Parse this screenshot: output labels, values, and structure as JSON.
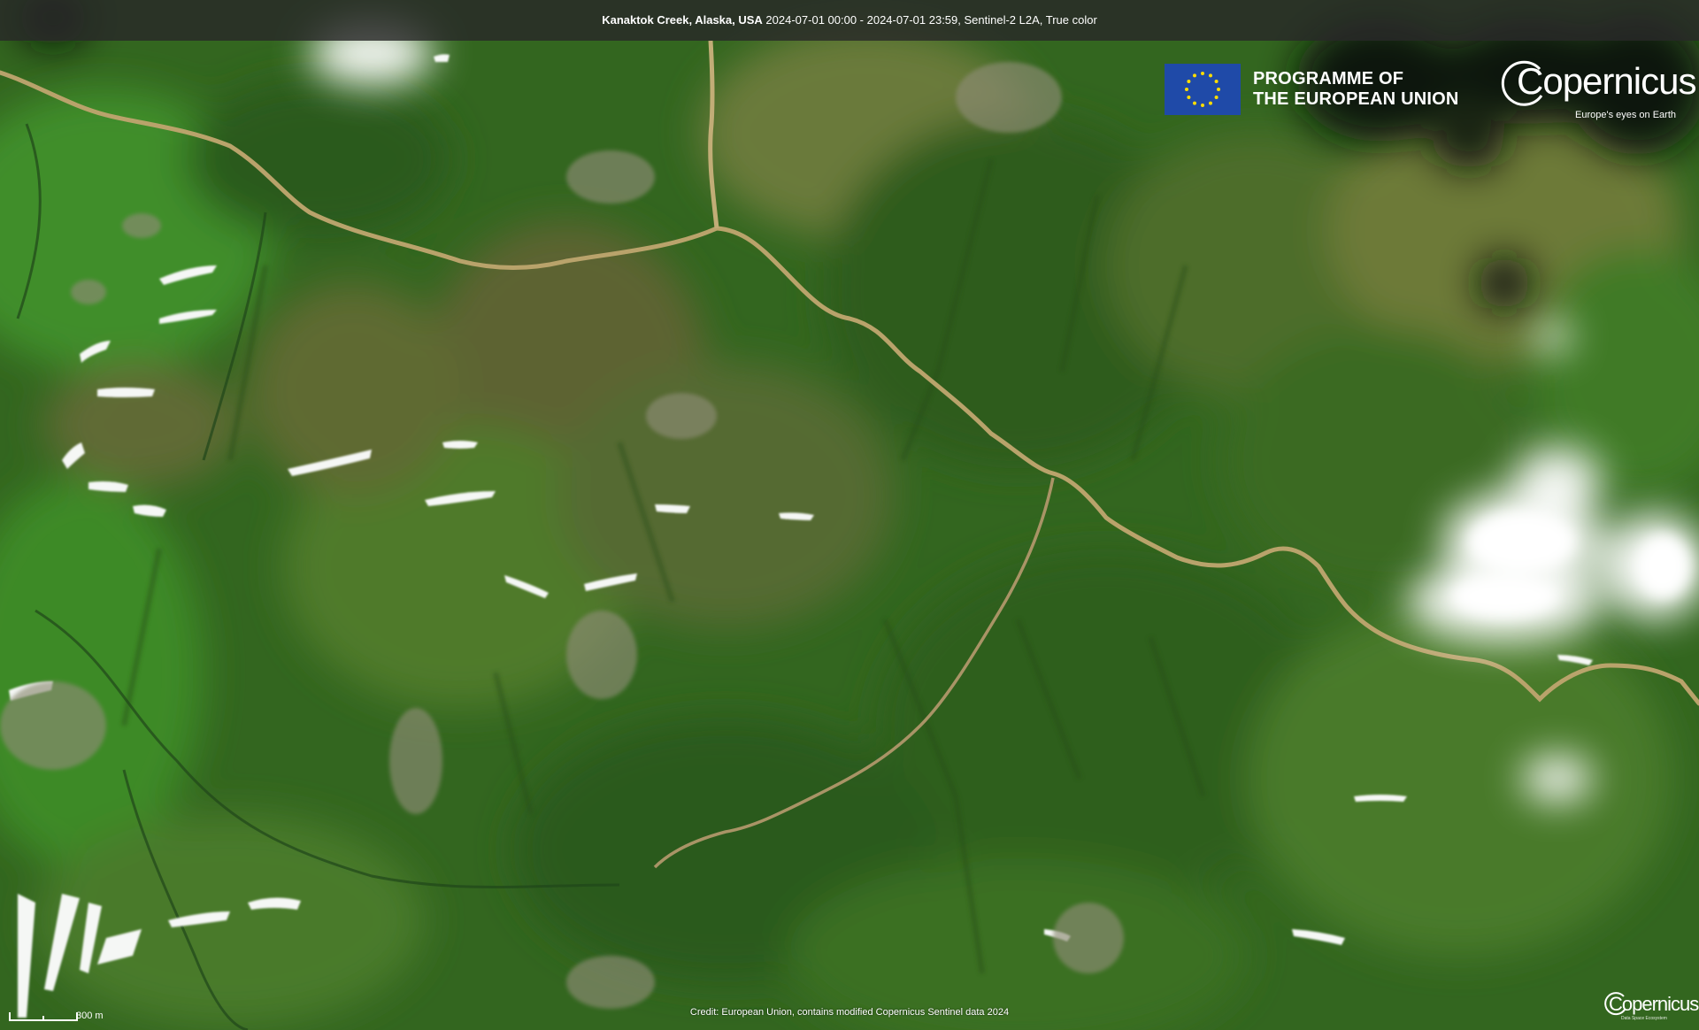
{
  "title_bar": {
    "location": "Kanaktok Creek, Alaska, USA",
    "details": " 2024-07-01 00:00 - 2024-07-01 23:59, Sentinel-2 L2A, True color"
  },
  "eu_logo": {
    "line1": "PROGRAMME OF",
    "line2": "THE EUROPEAN UNION",
    "flag_color": "#1f4aa8",
    "star_color": "#ffdd00"
  },
  "copernicus_logo": {
    "wordmark": "Copernicus",
    "tagline": "Europe's eyes on Earth"
  },
  "credit": "Credit: European Union, contains modified Copernicus Sentinel data 2024",
  "scale_bar": {
    "label": "300 m"
  },
  "mini_logo": {
    "wordmark": "Copernicus",
    "tagline": "Data Space Ecosystem"
  },
  "colors": {
    "vegetation_dark": "#2e5f1d",
    "vegetation_light": "#3f8a28",
    "tundra_brown": "#6b6a32",
    "river": "#b9a36b",
    "snow": "#f5f7f5",
    "cloud_shadow": "#0e120c"
  }
}
